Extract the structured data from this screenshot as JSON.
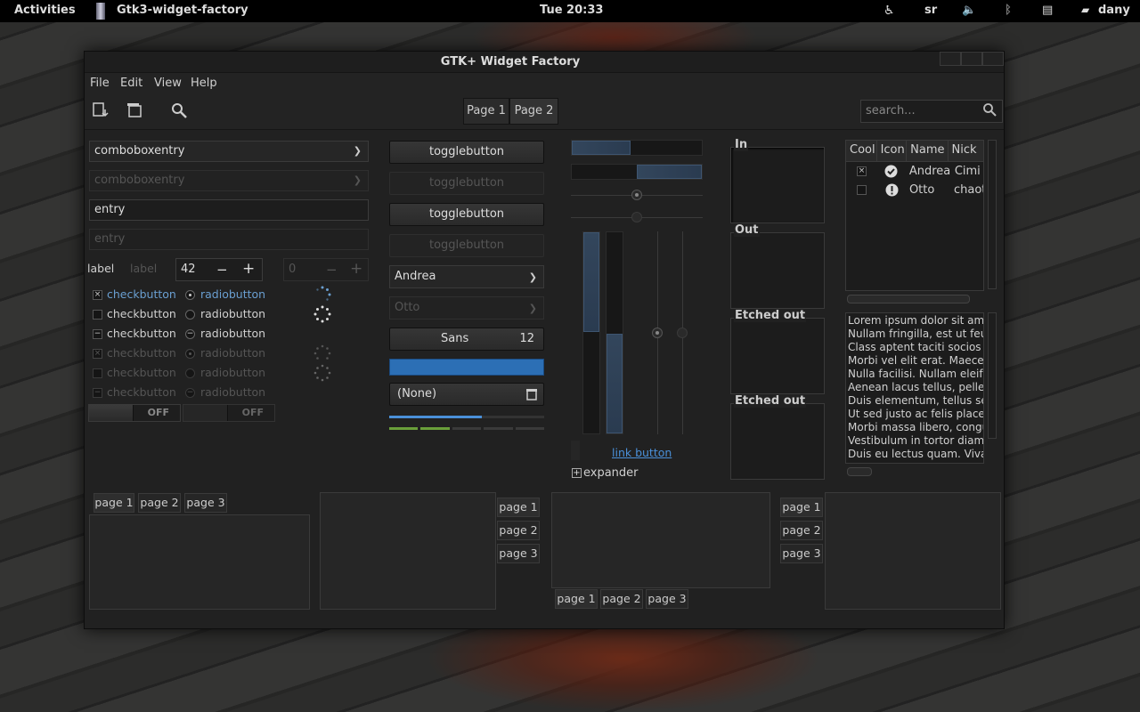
{
  "topbar": {
    "activities": "Activities",
    "app_name": "Gtk3-widget-factory",
    "clock": "Tue 20:33",
    "keyboard_layout": "sr",
    "user": "dany",
    "icons": [
      "accessibility-icon",
      "volume-icon",
      "bluetooth-icon",
      "clipboard-icon",
      "chat-icon"
    ]
  },
  "window": {
    "title": "GTK+ Widget Factory",
    "menu": [
      "File",
      "Edit",
      "View",
      "Help"
    ],
    "toolbar_icons": [
      "open-icon",
      "copy-icon",
      "find-icon"
    ],
    "page_tabs": [
      "Page 1",
      "Page 2"
    ],
    "search_placeholder": "search..."
  },
  "left": {
    "combo_active": "comboboxentry",
    "combo_disabled": "comboboxentry",
    "entry_active": "entry",
    "entry_disabled": "entry",
    "label_active": "label",
    "label_disabled": "label",
    "spin_value": "42",
    "spin_disabled_value": "0",
    "minus": "−",
    "plus": "+",
    "checkbutton": "checkbutton",
    "radiobutton": "radiobutton",
    "switch_off": "OFF"
  },
  "middle": {
    "togglebutton": "togglebutton",
    "combo_andrea": "Andrea",
    "combo_otto": "Otto",
    "font_name": "Sans",
    "font_size": "12",
    "file_none": "(None)",
    "progress_fraction": 0.6
  },
  "sliders": {
    "progress_top": 0.45,
    "progress_mid_start": 0.5,
    "hscale_value": 0.5,
    "link_button": "link button",
    "expander": "expander"
  },
  "frames": [
    "In",
    "Out",
    "Etched out",
    "Etched out"
  ],
  "tree": {
    "columns": [
      "Cool",
      "Icon",
      "Name",
      "Nick"
    ],
    "rows": [
      {
        "cool": "×",
        "icon": "check-circle-icon",
        "name": "Andrea",
        "nick": "Cimi"
      },
      {
        "cool": "",
        "icon": "warning-circle-icon",
        "name": "Otto",
        "nick": "chaot"
      }
    ]
  },
  "textview": [
    "Lorem ipsum dolor sit am",
    "Nullam fringilla, est ut feu",
    "Class aptent taciti socios",
    "Morbi vel elit erat. Maecer",
    "Nulla facilisi. Nullam eleife",
    "Aenean lacus tellus, peller",
    "Duis elementum, tellus se",
    "Ut sed justo ac felis place",
    "Morbi massa libero, congu",
    "Vestibulum in tortor diam",
    "Duis eu lectus quam. Vivar"
  ],
  "notebook_tabs": [
    "page 1",
    "page 2",
    "page 3"
  ],
  "colors": {
    "accent": "#2c6fb5",
    "link": "#4a90d9",
    "window_bg": "#212121"
  }
}
